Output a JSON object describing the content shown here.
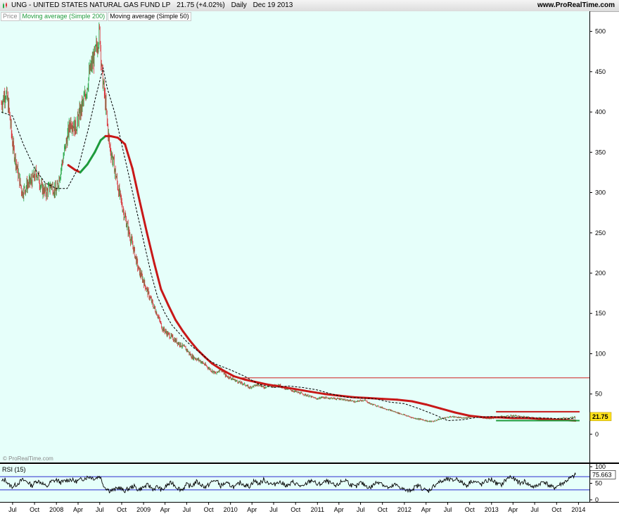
{
  "header": {
    "symbol": "UNG - UNITED STATES NATURAL GAS FUND LP",
    "quote": "21.75 (+4.02%)",
    "period": "Daily",
    "date": "Dec 19 2013",
    "site": "www.ProRealTime.com"
  },
  "legend": {
    "price": "Price",
    "ma200": "Moving average (Simple 200)",
    "ma50": "Moving average (Simple 50)"
  },
  "copyright": "© ProRealTime.com",
  "colors": {
    "background": "#e6fffa",
    "bull": "#2aa84a",
    "bear": "#d8343a",
    "ma200_falling": "#c81818",
    "ma200_rising": "#1e9b3c",
    "ma50": "#000000",
    "rsi": "#000000",
    "rsi_levels": "#2a2ad0",
    "level_line": "#d02020"
  },
  "chart_data": [
    {
      "type": "line",
      "panel": "price",
      "scale": "linear",
      "ylim": [
        -35,
        525
      ],
      "yticks": [
        0,
        50,
        100,
        150,
        200,
        250,
        300,
        350,
        400,
        450,
        500
      ],
      "x_start": "2007-05-15",
      "x_end": "2013-12-19",
      "xticks": [
        {
          "date": "2007-07-01",
          "label": "Jul"
        },
        {
          "date": "2007-10-01",
          "label": "Oct"
        },
        {
          "date": "2008-01-01",
          "label": "2008"
        },
        {
          "date": "2008-04-01",
          "label": "Apr"
        },
        {
          "date": "2008-07-01",
          "label": "Jul"
        },
        {
          "date": "2008-10-01",
          "label": "Oct"
        },
        {
          "date": "2009-01-01",
          "label": "2009"
        },
        {
          "date": "2009-04-01",
          "label": "Apr"
        },
        {
          "date": "2009-07-01",
          "label": "Jul"
        },
        {
          "date": "2009-10-01",
          "label": "Oct"
        },
        {
          "date": "2010-01-01",
          "label": "2010"
        },
        {
          "date": "2010-04-01",
          "label": "Apr"
        },
        {
          "date": "2010-07-01",
          "label": "Jul"
        },
        {
          "date": "2010-10-01",
          "label": "Oct"
        },
        {
          "date": "2011-01-01",
          "label": "2011"
        },
        {
          "date": "2011-04-01",
          "label": "Apr"
        },
        {
          "date": "2011-07-01",
          "label": "Jul"
        },
        {
          "date": "2011-10-01",
          "label": "Oct"
        },
        {
          "date": "2012-01-01",
          "label": "2012"
        },
        {
          "date": "2012-04-01",
          "label": "Apr"
        },
        {
          "date": "2012-07-01",
          "label": "Jul"
        },
        {
          "date": "2012-10-01",
          "label": "Oct"
        },
        {
          "date": "2013-01-01",
          "label": "2013"
        },
        {
          "date": "2013-04-01",
          "label": "Apr"
        },
        {
          "date": "2013-07-01",
          "label": "Jul"
        },
        {
          "date": "2013-10-01",
          "label": "Oct"
        },
        {
          "date": "2014-01-01",
          "label": "2014"
        }
      ],
      "last_price": "21.75",
      "series": [
        {
          "name": "Price",
          "style": "candles",
          "x": [
            "2007-05-15",
            "2007-06-01",
            "2007-06-15",
            "2007-07-01",
            "2007-07-20",
            "2007-08-10",
            "2007-09-01",
            "2007-09-20",
            "2007-10-10",
            "2007-11-01",
            "2007-11-20",
            "2007-12-10",
            "2008-01-01",
            "2008-01-20",
            "2008-02-10",
            "2008-03-01",
            "2008-03-20",
            "2008-04-10",
            "2008-05-01",
            "2008-05-20",
            "2008-06-10",
            "2008-07-01",
            "2008-07-10",
            "2008-07-25",
            "2008-08-10",
            "2008-09-01",
            "2008-09-20",
            "2008-10-10",
            "2008-11-01",
            "2008-11-20",
            "2008-12-10",
            "2009-01-01",
            "2009-01-20",
            "2009-02-10",
            "2009-03-01",
            "2009-03-20",
            "2009-04-10",
            "2009-05-01",
            "2009-05-20",
            "2009-06-10",
            "2009-07-01",
            "2009-07-20",
            "2009-08-10",
            "2009-09-01",
            "2009-09-20",
            "2009-10-10",
            "2009-11-01",
            "2009-11-20",
            "2009-12-10",
            "2010-01-01",
            "2010-01-20",
            "2010-02-10",
            "2010-03-01",
            "2010-03-20",
            "2010-04-10",
            "2010-05-01",
            "2010-05-20",
            "2010-06-10",
            "2010-07-01",
            "2010-07-20",
            "2010-08-10",
            "2010-09-01",
            "2010-09-20",
            "2010-10-10",
            "2010-11-01",
            "2010-11-20",
            "2010-12-10",
            "2011-01-01",
            "2011-01-20",
            "2011-02-10",
            "2011-03-01",
            "2011-03-20",
            "2011-04-10",
            "2011-05-01",
            "2011-05-20",
            "2011-06-10",
            "2011-07-01",
            "2011-07-20",
            "2011-08-10",
            "2011-09-01",
            "2011-09-20",
            "2011-10-10",
            "2011-11-01",
            "2011-11-20",
            "2011-12-10",
            "2012-01-01",
            "2012-01-20",
            "2012-02-10",
            "2012-03-01",
            "2012-03-20",
            "2012-04-10",
            "2012-05-01",
            "2012-05-20",
            "2012-06-10",
            "2012-07-01",
            "2012-07-20",
            "2012-08-10",
            "2012-09-01",
            "2012-09-20",
            "2012-10-10",
            "2012-11-01",
            "2012-11-20",
            "2012-12-10",
            "2013-01-01",
            "2013-01-20",
            "2013-02-10",
            "2013-03-01",
            "2013-03-20",
            "2013-04-10",
            "2013-05-01",
            "2013-05-20",
            "2013-06-10",
            "2013-07-01",
            "2013-07-20",
            "2013-08-10",
            "2013-09-01",
            "2013-09-20",
            "2013-10-10",
            "2013-11-01",
            "2013-11-20",
            "2013-12-10",
            "2013-12-19"
          ],
          "values": [
            410,
            425,
            405,
            360,
            330,
            300,
            310,
            315,
            325,
            305,
            300,
            310,
            300,
            330,
            360,
            390,
            380,
            400,
            420,
            450,
            470,
            500,
            450,
            410,
            360,
            330,
            300,
            275,
            250,
            230,
            205,
            190,
            175,
            160,
            148,
            132,
            125,
            120,
            115,
            110,
            105,
            97,
            94,
            90,
            85,
            80,
            75,
            82,
            73,
            70,
            67,
            64,
            62,
            58,
            60,
            62,
            58,
            60,
            60,
            62,
            58,
            56,
            54,
            52,
            50,
            48,
            46,
            44,
            46,
            45,
            45,
            44,
            44,
            42,
            42,
            40,
            42,
            42,
            38,
            36,
            34,
            32,
            30,
            28,
            26,
            24,
            22,
            20,
            19,
            18,
            16,
            16,
            18,
            20,
            21,
            22,
            21,
            20,
            21,
            22,
            22,
            21,
            20,
            20,
            21,
            22,
            22,
            23,
            23,
            22,
            22,
            21,
            20,
            20,
            20,
            19,
            18,
            19,
            20,
            20,
            21,
            22
          ]
        },
        {
          "name": "Moving average (Simple 200)",
          "style": "line",
          "x": [
            "2008-02-20",
            "2008-03-20",
            "2008-04-10",
            "2008-05-10",
            "2008-06-10",
            "2008-07-05",
            "2008-07-25",
            "2008-08-15",
            "2008-09-15",
            "2008-10-15",
            "2008-11-15",
            "2008-12-15",
            "2009-01-15",
            "2009-02-15",
            "2009-03-15",
            "2009-04-15",
            "2009-05-15",
            "2009-06-15",
            "2009-07-15",
            "2009-08-15",
            "2009-09-15",
            "2009-10-15",
            "2009-11-15",
            "2009-12-15",
            "2010-01-15",
            "2010-03-01",
            "2010-04-15",
            "2010-06-01",
            "2010-08-01",
            "2010-10-01",
            "2010-12-01",
            "2011-02-01",
            "2011-04-01",
            "2011-06-01",
            "2011-08-01",
            "2011-10-01",
            "2011-12-01",
            "2012-02-01",
            "2012-04-01",
            "2012-06-01",
            "2012-08-01",
            "2012-10-01",
            "2012-12-01",
            "2013-02-01",
            "2013-04-01",
            "2013-06-01",
            "2013-08-01",
            "2013-10-01",
            "2013-12-19"
          ],
          "values": [
            334,
            328,
            325,
            335,
            350,
            365,
            370,
            370,
            368,
            360,
            330,
            290,
            250,
            212,
            180,
            160,
            142,
            128,
            116,
            105,
            96,
            88,
            82,
            77,
            72,
            68,
            65,
            62,
            59,
            56,
            53,
            50,
            48,
            46,
            45,
            44,
            43,
            41,
            37,
            32,
            27,
            23,
            21,
            21,
            20,
            20,
            19,
            18,
            17
          ]
        },
        {
          "name": "Moving average (Simple 50)",
          "style": "line",
          "x": [
            "2007-05-15",
            "2007-07-01",
            "2007-08-15",
            "2007-10-01",
            "2007-11-15",
            "2008-01-01",
            "2008-02-15",
            "2008-04-01",
            "2008-05-15",
            "2008-06-15",
            "2008-07-15",
            "2008-08-01",
            "2008-09-01",
            "2008-10-01",
            "2008-11-01",
            "2008-12-01",
            "2009-01-01",
            "2009-02-01",
            "2009-03-01",
            "2009-04-01",
            "2009-05-01",
            "2009-06-01",
            "2009-07-01",
            "2009-08-01",
            "2009-09-01",
            "2009-10-01",
            "2009-11-01",
            "2010-01-01",
            "2010-03-01",
            "2010-05-01",
            "2010-07-01",
            "2010-09-01",
            "2010-11-01",
            "2011-01-01",
            "2011-03-01",
            "2011-05-01",
            "2011-07-01",
            "2011-09-01",
            "2011-11-01",
            "2012-01-01",
            "2012-03-01",
            "2012-05-01",
            "2012-07-01",
            "2012-09-01",
            "2012-11-01",
            "2013-01-01",
            "2013-03-01",
            "2013-05-01",
            "2013-07-01",
            "2013-09-01",
            "2013-11-01",
            "2013-12-19"
          ],
          "values": [
            400,
            395,
            360,
            330,
            312,
            305,
            305,
            330,
            380,
            420,
            455,
            430,
            400,
            360,
            320,
            280,
            240,
            200,
            170,
            150,
            135,
            125,
            115,
            107,
            100,
            92,
            87,
            80,
            72,
            62,
            58,
            60,
            58,
            55,
            50,
            46,
            45,
            44,
            40,
            38,
            32,
            25,
            17,
            18,
            21,
            22,
            21,
            21,
            20,
            20,
            19,
            20
          ]
        },
        {
          "name": "Level",
          "style": "hline",
          "x": [
            "2010-02-01",
            "2013-12-19"
          ],
          "values": [
            70,
            70
          ]
        }
      ]
    },
    {
      "type": "line",
      "panel": "rsi",
      "title": "RSI (15)",
      "ylim": [
        0,
        100
      ],
      "yticks": [
        0,
        50,
        100
      ],
      "levels": [
        30,
        70
      ],
      "last_value": "75.663",
      "series": [
        {
          "name": "RSI (15)",
          "x": [
            "2007-05-15",
            "2007-06-01",
            "2007-06-15",
            "2007-07-01",
            "2007-07-20",
            "2007-08-10",
            "2007-09-01",
            "2007-09-20",
            "2007-10-10",
            "2007-11-01",
            "2007-11-20",
            "2007-12-10",
            "2008-01-01",
            "2008-01-20",
            "2008-02-10",
            "2008-03-01",
            "2008-03-20",
            "2008-04-10",
            "2008-05-01",
            "2008-05-20",
            "2008-06-10",
            "2008-07-01",
            "2008-07-20",
            "2008-08-10",
            "2008-09-01",
            "2008-09-20",
            "2008-10-10",
            "2008-11-01",
            "2008-11-20",
            "2008-12-10",
            "2009-01-01",
            "2009-01-20",
            "2009-02-10",
            "2009-03-01",
            "2009-03-20",
            "2009-04-10",
            "2009-05-01",
            "2009-05-20",
            "2009-06-10",
            "2009-07-01",
            "2009-07-20",
            "2009-08-10",
            "2009-09-01",
            "2009-09-20",
            "2009-10-10",
            "2009-11-01",
            "2009-11-20",
            "2009-12-10",
            "2010-01-01",
            "2010-01-20",
            "2010-02-10",
            "2010-03-01",
            "2010-03-20",
            "2010-04-10",
            "2010-05-01",
            "2010-05-20",
            "2010-06-10",
            "2010-07-01",
            "2010-07-20",
            "2010-08-10",
            "2010-09-01",
            "2010-09-20",
            "2010-10-10",
            "2010-11-01",
            "2010-11-20",
            "2010-12-10",
            "2011-01-01",
            "2011-01-20",
            "2011-02-10",
            "2011-03-01",
            "2011-03-20",
            "2011-04-10",
            "2011-05-01",
            "2011-05-20",
            "2011-06-10",
            "2011-07-01",
            "2011-07-20",
            "2011-08-10",
            "2011-09-01",
            "2011-09-20",
            "2011-10-10",
            "2011-11-01",
            "2011-11-20",
            "2011-12-10",
            "2012-01-01",
            "2012-01-20",
            "2012-02-10",
            "2012-03-01",
            "2012-03-20",
            "2012-04-10",
            "2012-05-01",
            "2012-05-20",
            "2012-06-10",
            "2012-07-01",
            "2012-07-20",
            "2012-08-10",
            "2012-09-01",
            "2012-09-20",
            "2012-10-10",
            "2012-11-01",
            "2012-11-20",
            "2012-12-10",
            "2013-01-01",
            "2013-01-20",
            "2013-02-10",
            "2013-03-01",
            "2013-03-20",
            "2013-04-10",
            "2013-05-01",
            "2013-05-20",
            "2013-06-10",
            "2013-07-01",
            "2013-07-20",
            "2013-08-10",
            "2013-09-01",
            "2013-09-20",
            "2013-10-10",
            "2013-11-01",
            "2013-11-20",
            "2013-12-10",
            "2013-12-19"
          ],
          "values": [
            55,
            62,
            45,
            40,
            48,
            60,
            55,
            42,
            58,
            52,
            38,
            55,
            60,
            52,
            58,
            62,
            55,
            60,
            66,
            70,
            64,
            72,
            40,
            28,
            30,
            38,
            26,
            34,
            42,
            30,
            38,
            45,
            32,
            40,
            28,
            45,
            52,
            38,
            30,
            46,
            40,
            55,
            45,
            38,
            52,
            60,
            42,
            50,
            44,
            38,
            52,
            46,
            40,
            58,
            48,
            60,
            52,
            44,
            56,
            48,
            42,
            54,
            46,
            38,
            52,
            60,
            45,
            50,
            56,
            48,
            40,
            54,
            60,
            46,
            38,
            52,
            44,
            36,
            50,
            56,
            42,
            34,
            46,
            40,
            30,
            26,
            36,
            44,
            32,
            26,
            40,
            52,
            56,
            62,
            58,
            64,
            50,
            44,
            58,
            52,
            46,
            56,
            62,
            50,
            44,
            60,
            70,
            60,
            50,
            56,
            44,
            38,
            48,
            56,
            42,
            36,
            44,
            52,
            62,
            70,
            75.663
          ]
        }
      ]
    }
  ]
}
